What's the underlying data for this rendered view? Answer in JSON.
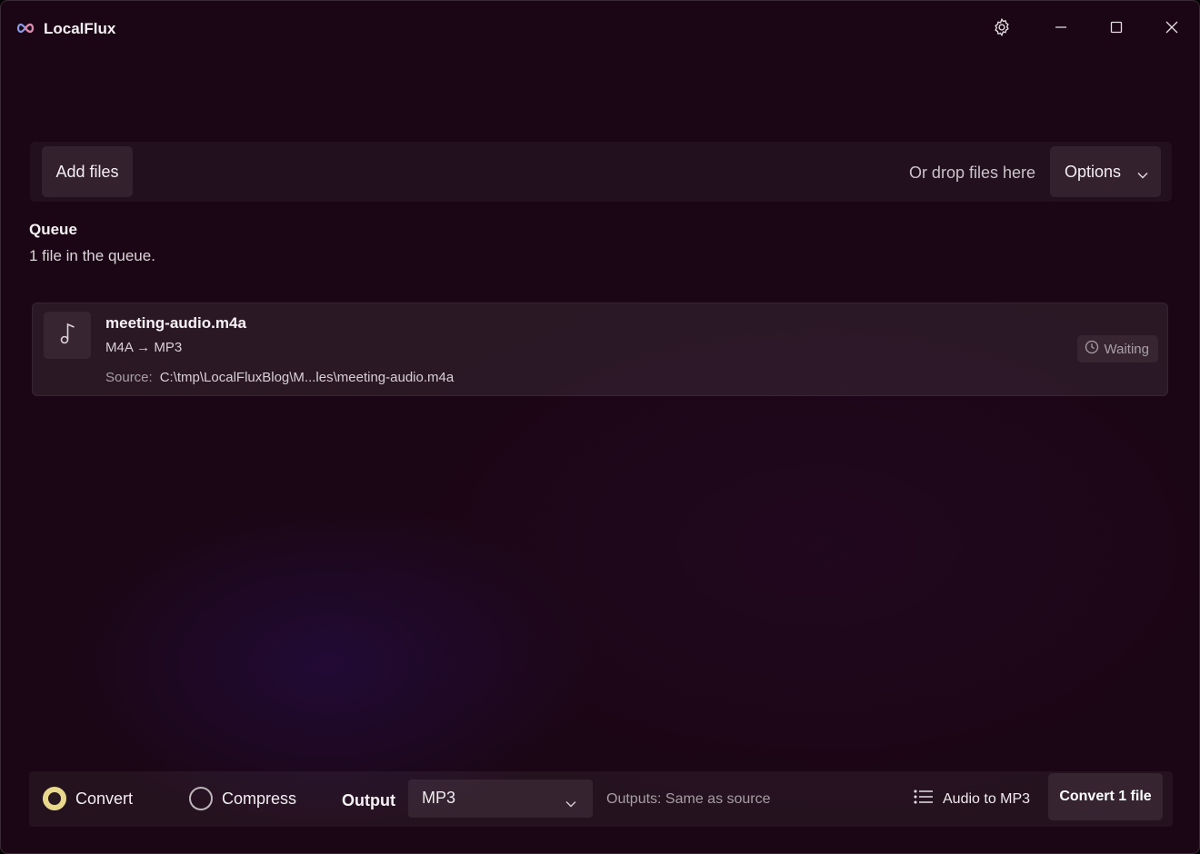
{
  "app": {
    "title": "LocalFlux",
    "logo_icon": "infinity-logo-icon",
    "window_controls": [
      "settings-icon",
      "minimize-icon",
      "maximize-icon",
      "close-icon"
    ]
  },
  "dropbar": {
    "add_files_label": "Add files",
    "drop_hint": "Or drop files here",
    "options_label": "Options"
  },
  "queue": {
    "title": "Queue",
    "count_text": "1 file in the queue.",
    "items": [
      {
        "icon": "music-note-icon",
        "name": "meeting-audio.m4a",
        "conversion": "M4A → MP3",
        "source_label": "Source:",
        "source_path": "C:\\tmp\\LocalFluxBlog\\M...les\\meeting-audio.m4a",
        "status": "Waiting",
        "status_icon": "clock-icon"
      }
    ]
  },
  "bottombar": {
    "mode_convert": "Convert",
    "mode_compress": "Compress",
    "selected_mode": "Convert",
    "output_label": "Output",
    "output_value": "MP3",
    "outputs_hint": "Outputs: Same as source",
    "preset_label": "Audio to MP3",
    "preset_icon": "list-icon",
    "convert_button": "Convert 1 file"
  },
  "colors": {
    "background": "#1a0614",
    "radio_accent": "#e8d98f"
  }
}
